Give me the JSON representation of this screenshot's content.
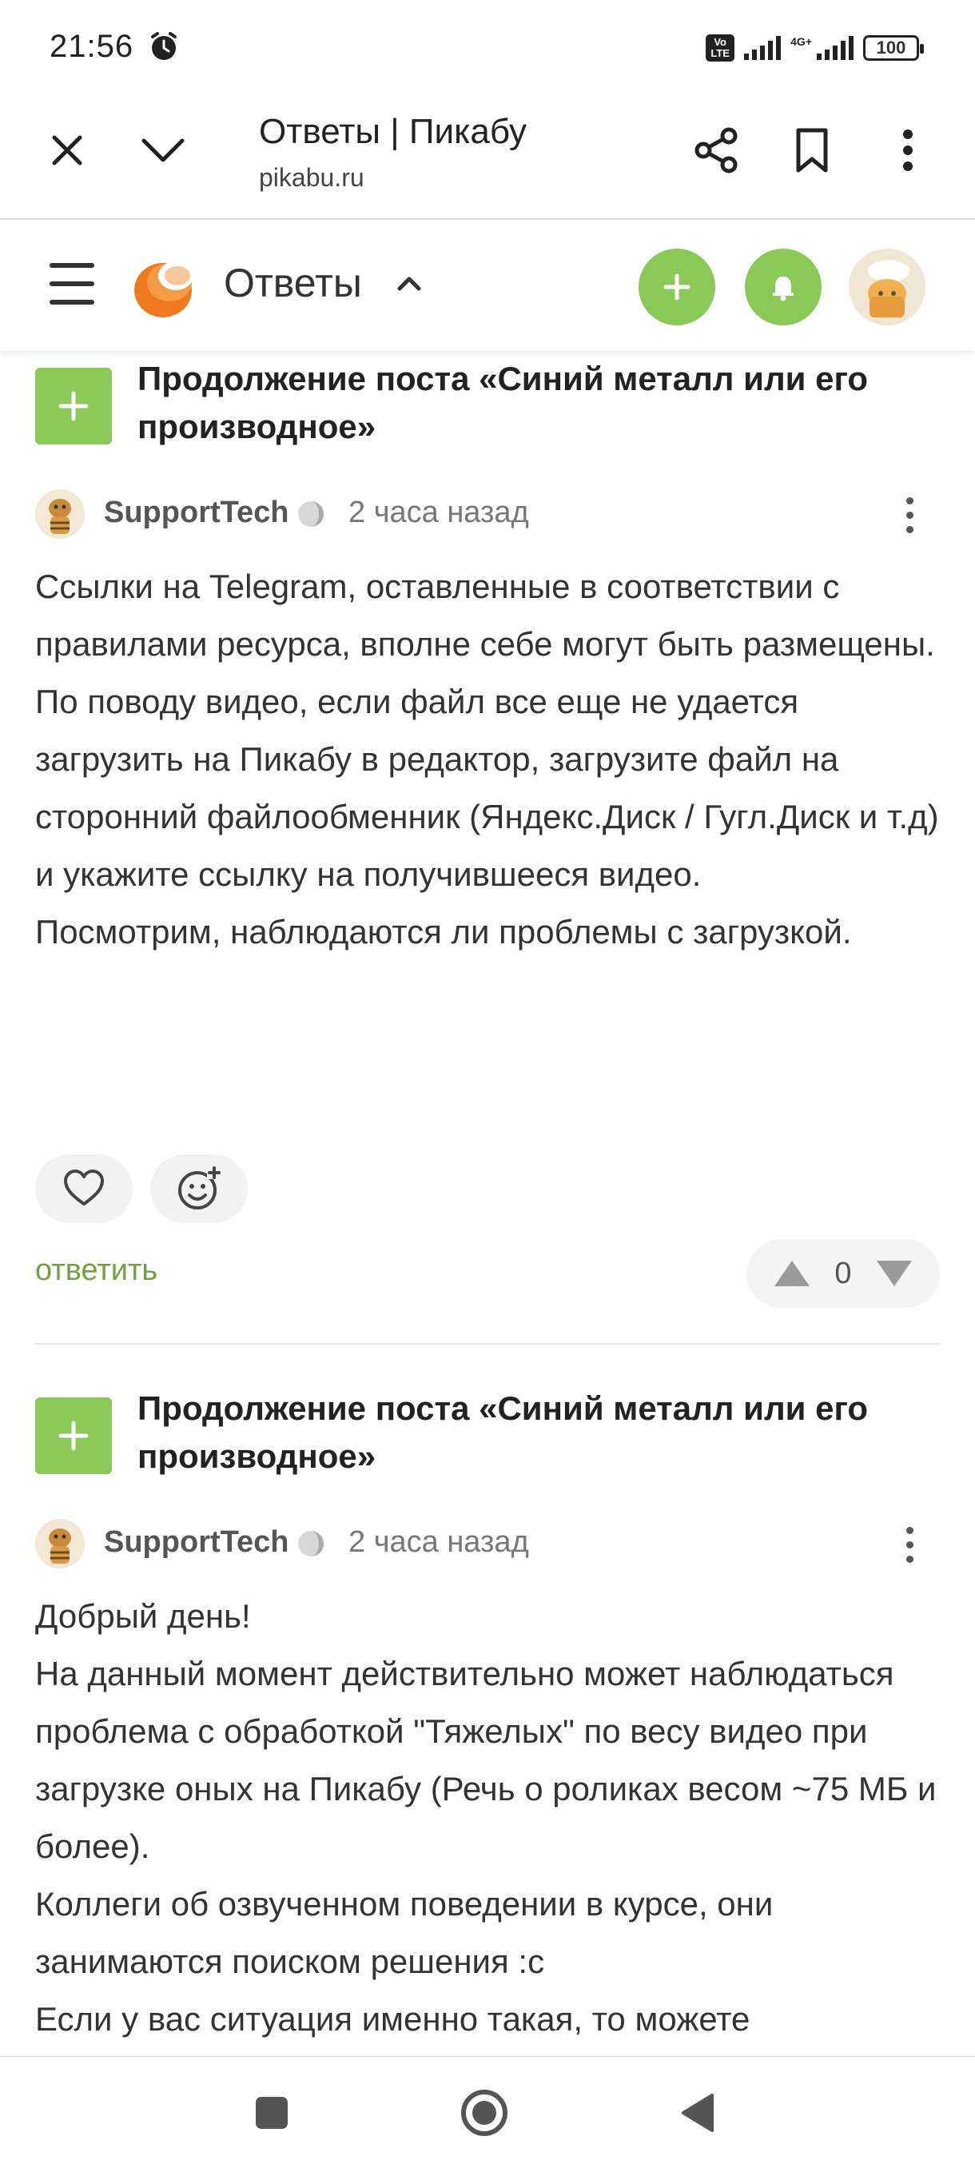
{
  "status_bar": {
    "time": "21:56",
    "volte": "Vo LTE",
    "network": "4G+",
    "battery": "100"
  },
  "browser": {
    "title": "Ответы | Пикабу",
    "url": "pikabu.ru",
    "icons": [
      "close-icon",
      "chevron-down-icon",
      "share-icon",
      "bookmark-icon",
      "more-vert-icon"
    ]
  },
  "site_header": {
    "section_title": "Ответы",
    "accent_color": "#8ac858"
  },
  "comments": [
    {
      "post_title": "Продолжение поста «Синий металл или его производное»",
      "username": "SupportTech",
      "time_ago": "2 часа назад",
      "lines": [
        "Ссылки на Telegram, оставленные в соответствии с правилами ресурса, вполне себе могут быть размещены.",
        "По поводу видео, если файл все еще не удается загрузить на Пикабу в редактор, загрузите файл на сторонний файлообменник (Яндекс.Диск / Гугл.Диск и т.д) и укажите ссылку на получившееся видео.",
        "Посмотрим, наблюдаются ли проблемы с загрузкой."
      ],
      "reply_label": "ответить",
      "rating": "0"
    },
    {
      "post_title": "Продолжение поста «Синий металл или его производное»",
      "username": "SupportTech",
      "time_ago": "2 часа назад",
      "lines": [
        "Добрый день!",
        "На данный момент действительно может наблюдаться проблема с обработкой \"Тяжелых\" по весу видео при загрузке оных на Пикабу (Речь о роликах весом ~75 МБ и более).",
        "Коллеги об озвученном поведении в курсе, они занимаются поиском решения :с",
        "Если у вас ситуация именно такая, то можете"
      ]
    }
  ]
}
